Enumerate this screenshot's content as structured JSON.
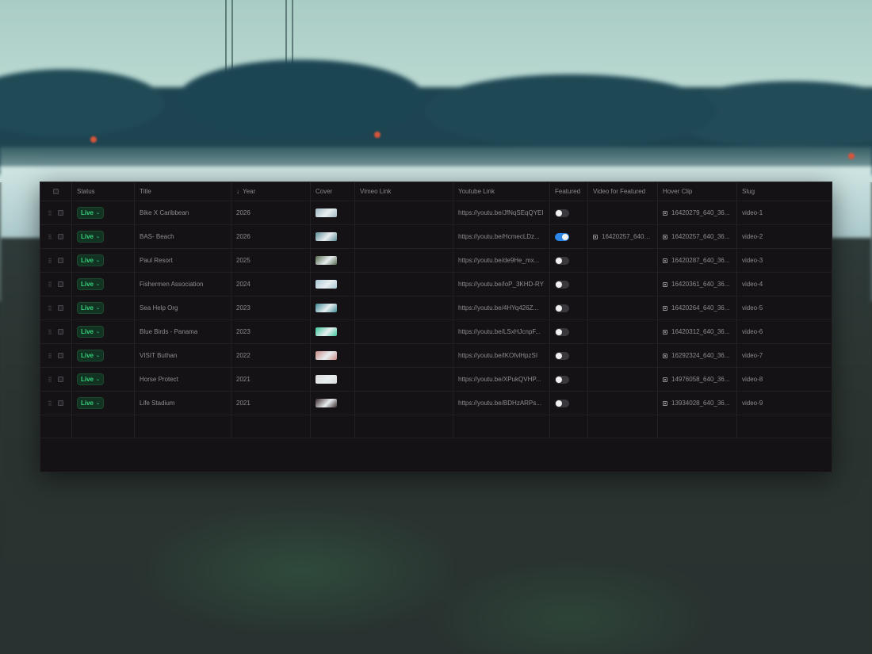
{
  "columns": {
    "status": "Status",
    "title": "Title",
    "year": "Year",
    "cover": "Cover",
    "vimeo": "Vimeo Link",
    "youtube": "Youtube Link",
    "featured": "Featured",
    "video_featured": "Video for Featured",
    "hover": "Hover Clip",
    "slug": "Slug"
  },
  "rows": [
    {
      "status": "Live",
      "title": "Bike X Caribbean",
      "year": "2026",
      "cover": "#9fb7c2",
      "vimeo": "",
      "youtube": "https://youtu.be/JfNqSEqQYEI",
      "featured": false,
      "video_featured": "",
      "hover": "16420279_640_36...",
      "slug": "video-1"
    },
    {
      "status": "Live",
      "title": "BAS- Beach",
      "year": "2026",
      "cover": "#5b8b96",
      "vimeo": "",
      "youtube": "https://youtu.be/HcmecLDz...",
      "featured": true,
      "video_featured": "16420257_640_...",
      "hover": "16420257_640_36...",
      "slug": "video-2"
    },
    {
      "status": "Live",
      "title": "Paul Resort",
      "year": "2025",
      "cover": "#556a4c",
      "vimeo": "",
      "youtube": "https://youtu.be/de9He_mx...",
      "featured": false,
      "video_featured": "",
      "hover": "16420287_640_36...",
      "slug": "video-3"
    },
    {
      "status": "Live",
      "title": "Fishermen Association",
      "year": "2024",
      "cover": "#a9c7d6",
      "vimeo": "",
      "youtube": "https://youtu.be/loP_3KHD-RY",
      "featured": false,
      "video_featured": "",
      "hover": "16420361_640_36...",
      "slug": "video-4"
    },
    {
      "status": "Live",
      "title": "Sea Help Org",
      "year": "2023",
      "cover": "#3f8a96",
      "vimeo": "",
      "youtube": "https://youtu.be/4HYq426Z...",
      "featured": false,
      "video_featured": "",
      "hover": "16420264_640_36...",
      "slug": "video-5"
    },
    {
      "status": "Live",
      "title": "Blue Birds - Panama",
      "year": "2023",
      "cover": "#39c79a",
      "vimeo": "",
      "youtube": "https://youtu.be/LSxHJcnpF...",
      "featured": false,
      "video_featured": "",
      "hover": "16420312_640_36...",
      "slug": "video-6"
    },
    {
      "status": "Live",
      "title": "VISIT Buthan",
      "year": "2022",
      "cover": "#c98a86",
      "vimeo": "",
      "youtube": "https://youtu.be/lKOfvlHpzSI",
      "featured": false,
      "video_featured": "",
      "hover": "16292324_640_36...",
      "slug": "video-7"
    },
    {
      "status": "Live",
      "title": "Horse Protect",
      "year": "2021",
      "cover": "#d9d9d9",
      "vimeo": "",
      "youtube": "https://youtu.be/XPukQVHP...",
      "featured": false,
      "video_featured": "",
      "hover": "14976058_640_36...",
      "slug": "video-8"
    },
    {
      "status": "Live",
      "title": "Life Stadium",
      "year": "2021",
      "cover": "#3a2a2c",
      "vimeo": "",
      "youtube": "https://youtu.be/BDHzARPs...",
      "featured": false,
      "video_featured": "",
      "hover": "13934028_640_36...",
      "slug": "video-9"
    }
  ]
}
